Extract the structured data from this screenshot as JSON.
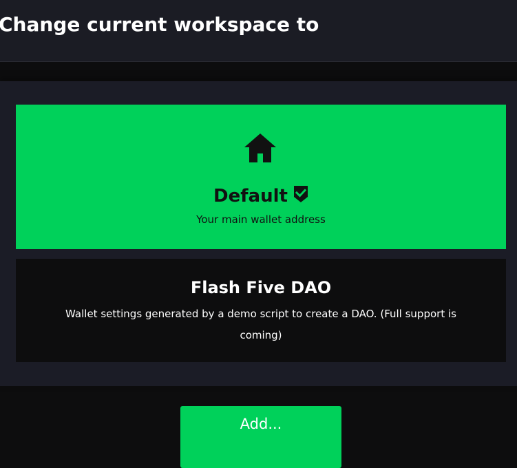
{
  "header": {
    "title": "Change current workspace to"
  },
  "workspaces": [
    {
      "name": "Default",
      "description": "Your main wallet address",
      "icon": "home-icon",
      "selected": true,
      "selected_icon": "check-badge-icon",
      "background": "#00d15a"
    },
    {
      "name": "Flash Five DAO",
      "description": "Wallet settings generated by a demo script to create a DAO. (Full support is coming)",
      "selected": false,
      "background": "#0d0d0e"
    }
  ],
  "actions": {
    "add_label": "Add..."
  },
  "colors": {
    "accent": "#00d15a",
    "header_bg": "#1b1c24",
    "panel_bg": "#1b1c26",
    "page_bg": "#0d0d0e"
  }
}
